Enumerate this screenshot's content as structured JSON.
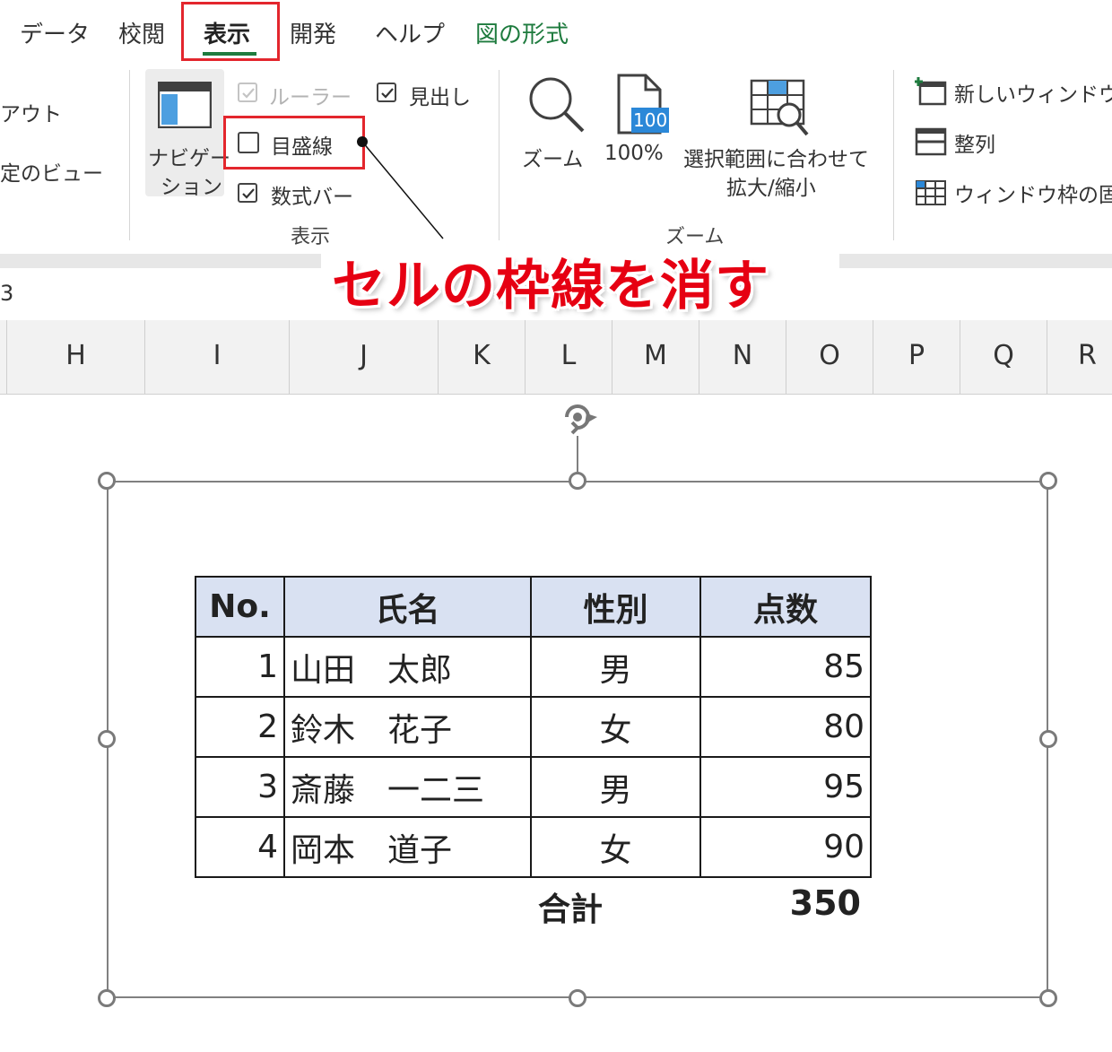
{
  "tabs": [
    {
      "label": "データ"
    },
    {
      "label": "校閲"
    },
    {
      "label": "表示",
      "active": true
    },
    {
      "label": "開発"
    },
    {
      "label": "ヘルプ"
    },
    {
      "label": "図の形式",
      "color": "#1e7b3e"
    }
  ],
  "ribbon": {
    "left_items": [
      "アウト",
      "定のビュー"
    ],
    "navigation_line1": "ナビゲー",
    "navigation_line2": "ション",
    "checkboxes": {
      "ruler": {
        "label": "ルーラー",
        "checked": true,
        "disabled": true
      },
      "headings": {
        "label": "見出し",
        "checked": true
      },
      "gridlines": {
        "label": "目盛線",
        "checked": false
      },
      "formula_bar": {
        "label": "数式バー",
        "checked": true
      }
    },
    "group_show": "表示",
    "zoom": {
      "label": "ズーム"
    },
    "zoom100": {
      "label": "100%",
      "icon_text": "100"
    },
    "zoom_selection": {
      "line1": "選択範囲に合わせて",
      "line2": "拡大/縮小"
    },
    "group_zoom": "ズーム",
    "window": {
      "new_window": "新しいウィンドウを",
      "arrange": "整列",
      "freeze": "ウィンドウ枠の固定"
    }
  },
  "formula_bar_fragment": "3",
  "annotation": "セルの枠線を消す",
  "columns": [
    "H",
    "I",
    "J",
    "K",
    "L",
    "M",
    "N",
    "O",
    "P",
    "Q",
    "R"
  ],
  "table": {
    "headers": [
      "No.",
      "氏名",
      "性別",
      "点数"
    ],
    "rows": [
      {
        "no": "1",
        "name": "山田　太郎",
        "sex": "男",
        "score": "85"
      },
      {
        "no": "2",
        "name": "鈴木　花子",
        "sex": "女",
        "score": "80"
      },
      {
        "no": "3",
        "name": "斎藤　一二三",
        "sex": "男",
        "score": "95"
      },
      {
        "no": "4",
        "name": "岡本　道子",
        "sex": "女",
        "score": "90"
      }
    ],
    "total_label": "合計",
    "total_value": "350",
    "header_bg": "#d9e1f2"
  },
  "accent_colors": {
    "highlight_red": "#e3262d",
    "annotation_red": "#e60012",
    "excel_green": "#1e7b3e"
  }
}
